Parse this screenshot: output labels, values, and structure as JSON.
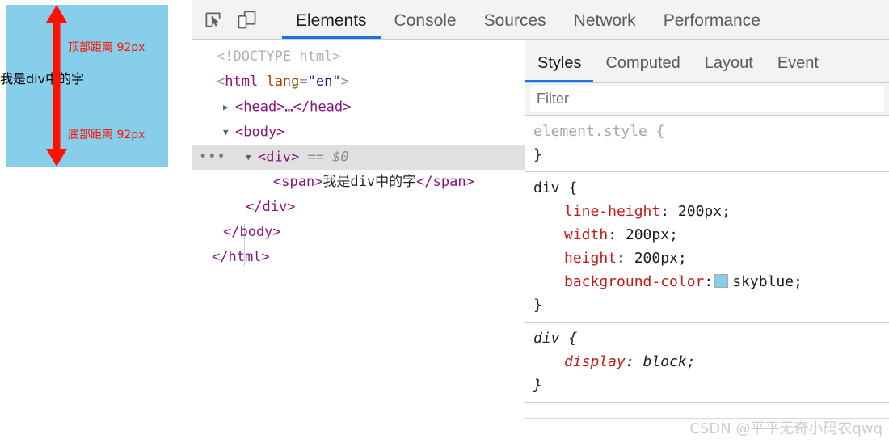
{
  "viewport": {
    "div_text": "我是div中的字",
    "annotation_top": "顶部距离 92px",
    "annotation_bottom": "底部距离 92px",
    "div_background_color": "#87ceeb",
    "arrow_color": "#ff1100",
    "annotation_color": "#ff1100"
  },
  "devtools": {
    "toolbar": {
      "inspect_icon": "inspect-element-icon",
      "device_icon": "device-toolbar-icon",
      "tabs": [
        {
          "label": "Elements",
          "active": true
        },
        {
          "label": "Console",
          "active": false
        },
        {
          "label": "Sources",
          "active": false
        },
        {
          "label": "Network",
          "active": false
        },
        {
          "label": "Performance",
          "active": false
        }
      ],
      "active_tab_underline_color": "#1a73e8"
    },
    "dom_tree": {
      "rows": [
        {
          "id": "doctype",
          "selected": false
        },
        {
          "id": "html",
          "selected": false
        },
        {
          "id": "head",
          "selected": false
        },
        {
          "id": "body",
          "selected": false
        },
        {
          "id": "div",
          "selected": true
        },
        {
          "id": "span",
          "selected": false
        },
        {
          "id": "div-end",
          "selected": false
        },
        {
          "id": "body-end",
          "selected": false
        },
        {
          "id": "html-end",
          "selected": false
        }
      ],
      "doctype": "<!DOCTYPE html>",
      "html_open_lt": "<",
      "html_tag": "html",
      "html_attr_name": "lang",
      "html_attr_eq": "=",
      "html_attr_value": "\"en\"",
      "html_open_gt": ">",
      "head_collapsed": "<head>…</head>",
      "body_open": "<body>",
      "div_open": "<div>",
      "div_selected_marker": "== $0",
      "div_ellipsis_badge": "•••",
      "span_open": "<span>",
      "span_text": "我是div中的字",
      "span_close": "</span>",
      "div_close": "</div>",
      "body_close": "</body>",
      "html_close": "</html>",
      "expand_triangle": "▼",
      "collapse_triangle": "▶"
    },
    "styles_panel": {
      "tabs": [
        {
          "label": "Styles",
          "active": true
        },
        {
          "label": "Computed",
          "active": false
        },
        {
          "label": "Layout",
          "active": false
        },
        {
          "label": "Event",
          "active": false
        }
      ],
      "filter_placeholder": "Filter",
      "filter_value": "",
      "rules": [
        {
          "selector": "element.style",
          "open_brace": "{",
          "close_brace": "}",
          "origin": "inline",
          "declarations": []
        },
        {
          "selector": "div",
          "open_brace": "{",
          "close_brace": "}",
          "origin": "author",
          "declarations": [
            {
              "property": "line-height",
              "value": "200px",
              "swatch": null
            },
            {
              "property": "width",
              "value": "200px",
              "swatch": null
            },
            {
              "property": "height",
              "value": "200px",
              "swatch": null
            },
            {
              "property": "background-color",
              "value": "skyblue",
              "swatch": "#87ceeb"
            }
          ]
        },
        {
          "selector": "div",
          "open_brace": "{",
          "close_brace": "}",
          "origin": "user-agent",
          "declarations": [
            {
              "property": "display",
              "value": "block",
              "swatch": null
            }
          ]
        }
      ]
    },
    "watermark": "CSDN @平平无奇小码农qwq"
  }
}
